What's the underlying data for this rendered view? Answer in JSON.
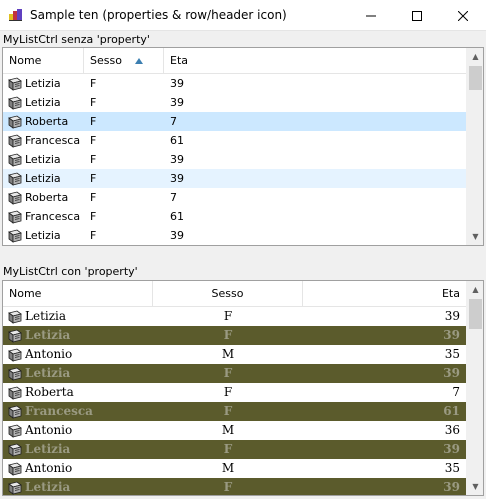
{
  "window": {
    "title": "Sample ten (properties & row/header icon)",
    "minimize_glyph": "—",
    "maximize_glyph": "☐",
    "close_glyph": "✕"
  },
  "list1": {
    "label": "MyListCtrl senza 'property'",
    "headers": {
      "nome": "Nome",
      "sesso": "Sesso",
      "eta": "Eta"
    },
    "sort_column": "Sesso",
    "sort_direction": "ascending",
    "rows": [
      {
        "nome": "Letizia",
        "sesso": "F",
        "eta": "39",
        "state": "normal"
      },
      {
        "nome": "Letizia",
        "sesso": "F",
        "eta": "39",
        "state": "normal"
      },
      {
        "nome": "Roberta",
        "sesso": "F",
        "eta": "7",
        "state": "selected"
      },
      {
        "nome": "Francesca",
        "sesso": "F",
        "eta": "61",
        "state": "normal"
      },
      {
        "nome": "Letizia",
        "sesso": "F",
        "eta": "39",
        "state": "normal"
      },
      {
        "nome": "Letizia",
        "sesso": "F",
        "eta": "39",
        "state": "hover"
      },
      {
        "nome": "Roberta",
        "sesso": "F",
        "eta": "7",
        "state": "normal"
      },
      {
        "nome": "Francesca",
        "sesso": "F",
        "eta": "61",
        "state": "normal"
      },
      {
        "nome": "Letizia",
        "sesso": "F",
        "eta": "39",
        "state": "normal"
      }
    ]
  },
  "list2": {
    "label": "MyListCtrl con 'property'",
    "headers": {
      "nome": "Nome",
      "sesso": "Sesso",
      "eta": "Eta"
    },
    "rows": [
      {
        "nome": "Letizia",
        "sesso": "F",
        "eta": "39",
        "style": "normal"
      },
      {
        "nome": "Letizia",
        "sesso": "F",
        "eta": "39",
        "style": "highlighted"
      },
      {
        "nome": "Antonio",
        "sesso": "M",
        "eta": "35",
        "style": "normal"
      },
      {
        "nome": "Letizia",
        "sesso": "F",
        "eta": "39",
        "style": "highlighted"
      },
      {
        "nome": "Roberta",
        "sesso": "F",
        "eta": "7",
        "style": "normal"
      },
      {
        "nome": "Francesca",
        "sesso": "F",
        "eta": "61",
        "style": "highlighted"
      },
      {
        "nome": "Antonio",
        "sesso": "M",
        "eta": "36",
        "style": "normal"
      },
      {
        "nome": "Letizia",
        "sesso": "F",
        "eta": "39",
        "style": "highlighted"
      },
      {
        "nome": "Antonio",
        "sesso": "M",
        "eta": "35",
        "style": "normal"
      },
      {
        "nome": "Letizia",
        "sesso": "F",
        "eta": "39",
        "style": "highlighted"
      }
    ]
  },
  "icons": {
    "app": "app-logo-icon",
    "row": "document-icon",
    "sort": "sort-ascending-icon"
  },
  "colors": {
    "selected_row": "#cce8ff",
    "hover_row": "#e5f3ff",
    "highlight_row_bg": "#5b5b2c",
    "highlight_row_text": "#9a9a82"
  }
}
